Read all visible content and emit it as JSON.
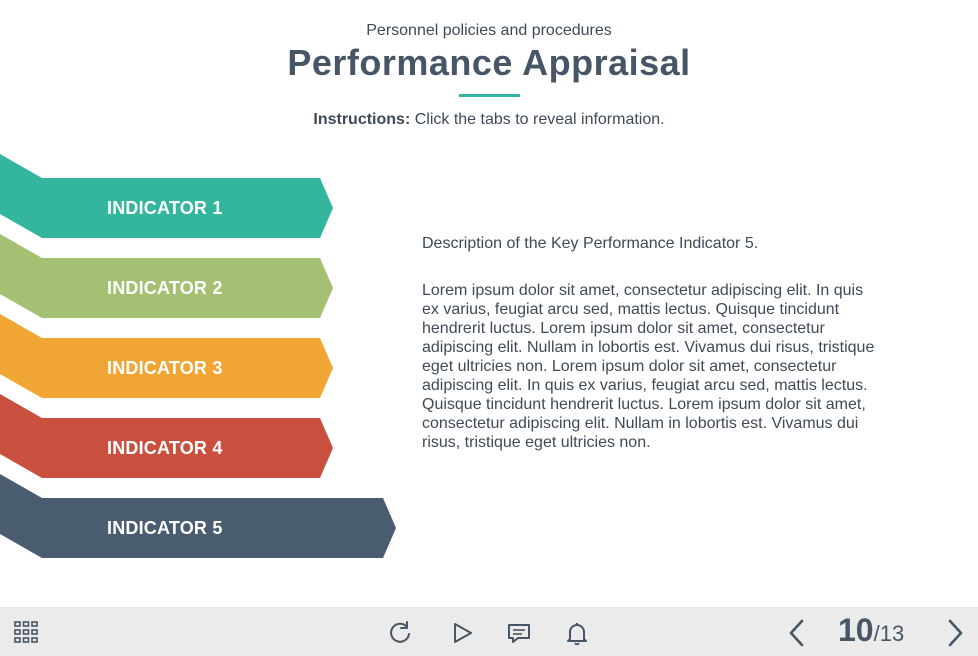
{
  "header": {
    "subtitle": "Personnel policies and procedures",
    "title": "Performance Appraisal",
    "instructions_label": "Instructions:",
    "instructions_text": " Click the tabs to reveal information."
  },
  "tabs": [
    {
      "label": "INDICATOR 1",
      "color": "#33b59e"
    },
    {
      "label": "INDICATOR 2",
      "color": "#a4c073"
    },
    {
      "label": "INDICATOR 3",
      "color": "#f0a535"
    },
    {
      "label": "INDICATOR 4",
      "color": "#c94f3f"
    },
    {
      "label": "INDICATOR 5",
      "color": "#4a5c70",
      "active": true
    }
  ],
  "content": {
    "heading": "Description of the Key Performance Indicator 5.",
    "body": "Lorem ipsum dolor sit amet, consectetur adipiscing elit. In quis ex varius, feugiat arcu sed, mattis lectus. Quisque tincidunt hendrerit luctus. Lorem ipsum dolor sit amet, consectetur adipiscing elit. Nullam in lobortis est. Vivamus dui risus, tristique eget ultricies non. Lorem ipsum dolor sit amet, consectetur adipiscing elit. In quis ex varius, feugiat arcu sed, mattis lectus. Quisque tincidunt hendrerit luctus. Lorem ipsum dolor sit amet, consectetur adipiscing elit. Nullam in lobortis est. Vivamus dui risus, tristique eget ultricies non."
  },
  "footer": {
    "icons": [
      "grid-menu-icon",
      "replay-icon",
      "play-icon",
      "comment-icon",
      "bell-icon",
      "chevron-left-icon",
      "chevron-right-icon"
    ],
    "page_current": "10",
    "page_separator": "/",
    "page_total": "13",
    "icon_color": "#475666"
  }
}
